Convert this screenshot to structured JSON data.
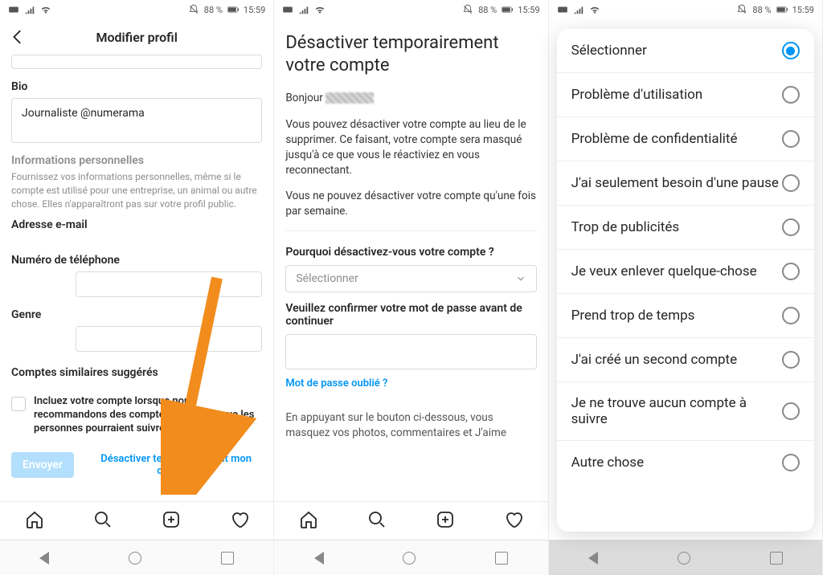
{
  "status": {
    "battery": "88 %",
    "time": "15:59"
  },
  "pane1": {
    "header_title": "Modifier profil",
    "bio_label": "Bio",
    "bio_value": "Journaliste @numerama",
    "info_section": "Informations personnelles",
    "info_helper": "Fournissez vos informations personnelles, même si le compte est utilisé pour une entreprise, un animal ou autre chose. Elles n'apparaîtront pas sur votre profil public.",
    "email_label": "Adresse e-mail",
    "phone_label": "Numéro de téléphone",
    "gender_label": "Genre",
    "similar_section": "Comptes similaires suggérés",
    "similar_helper": "Incluez votre compte lorsque nous recommandons des comptes similaires que les personnes pourraient suivre.",
    "submit_btn": "Envoyer",
    "deactivate_link": "Désactiver temporairement mon compte."
  },
  "pane2": {
    "title": "Désactiver temporairement votre compte",
    "greeting": "Bonjour",
    "para1": "Vous pouvez désactiver votre compte au lieu de le supprimer. Ce faisant, votre compte sera masqué jusqu'à ce que vous le réactiviez en vous reconnectant.",
    "para2": "Vous ne pouvez désactiver votre compte qu'une fois par semaine.",
    "reason_label": "Pourquoi désactivez-vous votre compte ?",
    "select_placeholder": "Sélectionner",
    "confirm_label": "Veuillez confirmer votre mot de passe avant de continuer",
    "forgot_link": "Mot de passe oublié ?",
    "footer_para": "En appuyant sur le bouton ci-dessous, vous masquez vos photos, commentaires et J'aime"
  },
  "pane3": {
    "options": [
      "Sélectionner",
      "Problème d'utilisation",
      "Problème de confidentialité",
      "J'ai seulement besoin d'une pause",
      "Trop de publicités",
      "Je veux enlever quelque-chose",
      "Prend trop de temps",
      "J'ai créé un second compte",
      "Je ne trouve aucun compte à suivre",
      "Autre chose"
    ],
    "selected_index": 0
  }
}
